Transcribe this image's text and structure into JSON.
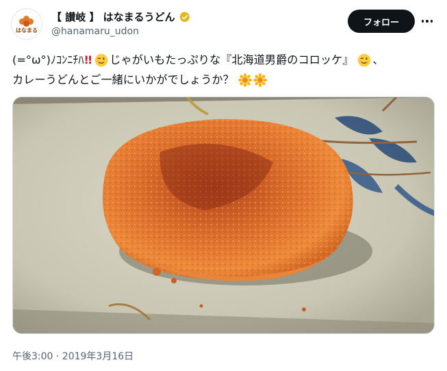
{
  "account": {
    "display_name": "【 讃岐 】 はなまるうどん",
    "handle": "@hanamaru_udon",
    "avatar_text": "はなまる",
    "verified": true,
    "verified_color": "#e2b719"
  },
  "actions": {
    "follow_label": "フォロー"
  },
  "tweet": {
    "line1_prefix": "(=°ω°)ﾉｺﾝﾆﾁﾊ",
    "line1_bang": "!!",
    "line1_main": "じゃがいもたっぷりな『北海道男爵のコロッケ』",
    "line1_end": "、",
    "line2_main": "カレーうどんとご一緒にいかがでしょうか？",
    "emoji": [
      "winking-face",
      "winking-face",
      "sunflower",
      "sunflower"
    ]
  },
  "media": {
    "description_icon": "croquette-photo"
  },
  "meta": {
    "timestamp": "午後3:00 · 2019年3月16日"
  },
  "colors": {
    "accent_dark": "#0f1419",
    "secondary_text": "#536471",
    "bang_red": "#d4162a"
  }
}
